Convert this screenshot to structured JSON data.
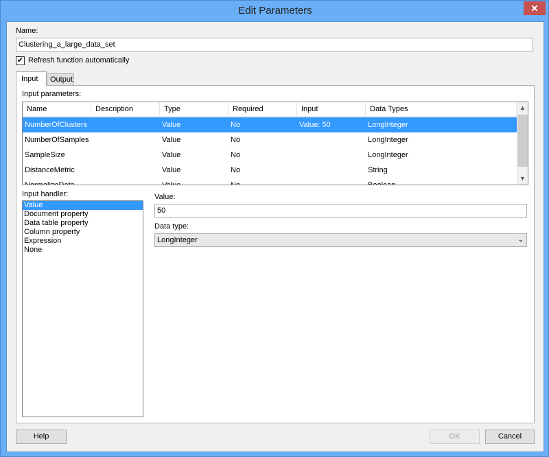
{
  "window": {
    "title": "Edit Parameters",
    "close_icon": "close-icon"
  },
  "name": {
    "label": "Name:",
    "value": "Clustering_a_large_data_set"
  },
  "refresh": {
    "label": "Refresh function automatically",
    "checked": true
  },
  "tabs": [
    {
      "label": "Input",
      "active": true
    },
    {
      "label": "Output",
      "active": false
    }
  ],
  "params": {
    "label": "Input parameters:",
    "columns": [
      "Name",
      "Description",
      "Type",
      "Required",
      "Input",
      "Data Types"
    ],
    "rows": [
      [
        "NumberOfClusters",
        "",
        "Value",
        "No",
        "Value: 50",
        "LongInteger"
      ],
      [
        "NumberOfSamples",
        "",
        "Value",
        "No",
        "",
        "LongInteger"
      ],
      [
        "SampleSize",
        "",
        "Value",
        "No",
        "",
        "LongInteger"
      ],
      [
        "DistanceMetric",
        "",
        "Value",
        "No",
        "",
        "String"
      ],
      [
        "NormalizeData",
        "",
        "Value",
        "No",
        "",
        "Boolean"
      ]
    ],
    "selected_row": 0
  },
  "handler": {
    "label": "Input handler:",
    "items": [
      "Value",
      "Document property",
      "Data table property",
      "Column property",
      "Expression",
      "None"
    ],
    "selected": 0
  },
  "value": {
    "label": "Value:",
    "value": "50"
  },
  "datatype": {
    "label": "Data type:",
    "value": "LongInteger"
  },
  "buttons": {
    "help": "Help",
    "ok": "OK",
    "cancel": "Cancel"
  }
}
